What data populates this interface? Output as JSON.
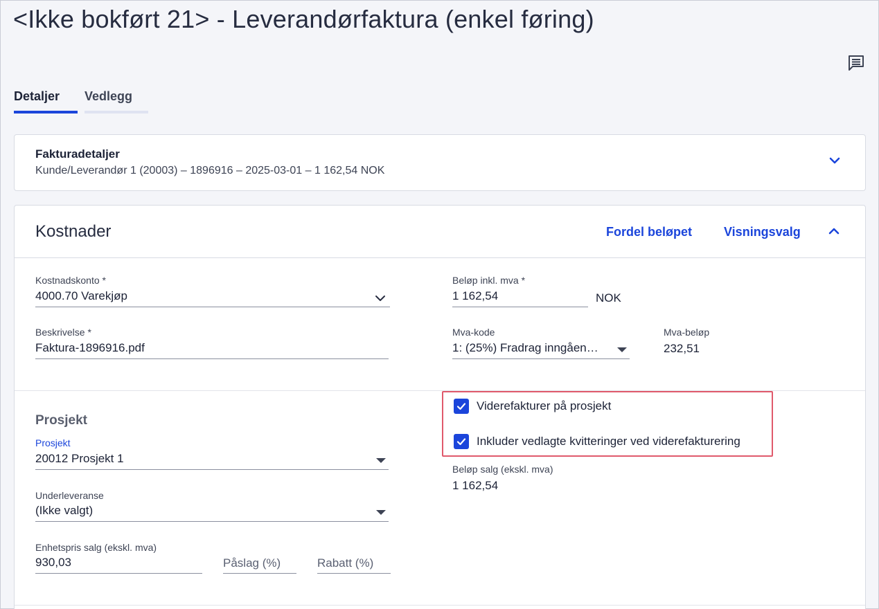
{
  "page": {
    "title": "<Ikke bokført 21> - Leverandørfaktura (enkel føring)"
  },
  "header": {
    "comment_icon": "comment-icon"
  },
  "tabs": [
    {
      "label": "Detaljer",
      "active": true
    },
    {
      "label": "Vedlegg",
      "active": false
    }
  ],
  "invoice_details": {
    "title": "Fakturadetaljer",
    "summary": "Kunde/Leverandør 1 (20003) – 1896916 – 2025-03-01 – 1 162,54 NOK",
    "toggle_icon": "chevron-down-icon"
  },
  "costs": {
    "title": "Kostnader",
    "distribute_label": "Fordel beløpet",
    "view_options_label": "Visningsvalg",
    "toggle_icon": "chevron-up-icon",
    "cost_account": {
      "label": "Kostnadskonto *",
      "value": "4000.70 Varekjøp"
    },
    "amount_incl_vat": {
      "label": "Beløp inkl. mva *",
      "value": "1 162,54",
      "currency": "NOK"
    },
    "description": {
      "label": "Beskrivelse *",
      "value": "Faktura-1896916.pdf"
    },
    "vat_code": {
      "label": "Mva-kode",
      "value": "1: (25%) Fradrag inngåen…"
    },
    "vat_amount": {
      "label": "Mva-beløp",
      "value": "232,51"
    }
  },
  "project": {
    "section_title": "Prosjekt",
    "project_field": {
      "label": "Prosjekt",
      "value": "20012 Prosjekt 1"
    },
    "subdelivery": {
      "label": "Underleveranse",
      "value": "(Ikke valgt)"
    },
    "unit_price": {
      "label": "Enhetspris salg (ekskl. mva)",
      "value": "930,03"
    },
    "markup": {
      "placeholder": "Påslag (%)"
    },
    "discount": {
      "placeholder": "Rabatt (%)"
    },
    "rebill_checkbox": {
      "label": "Viderefakturer på prosjekt",
      "checked": true
    },
    "include_receipts_checkbox": {
      "label": "Inkluder vedlagte kvitteringer ved viderefakturering",
      "checked": true
    },
    "sales_amount": {
      "label": "Beløp salg (ekskl. mva)",
      "value": "1 162,54"
    }
  },
  "colors": {
    "accent": "#1b45db",
    "highlight": "#e0596b"
  }
}
